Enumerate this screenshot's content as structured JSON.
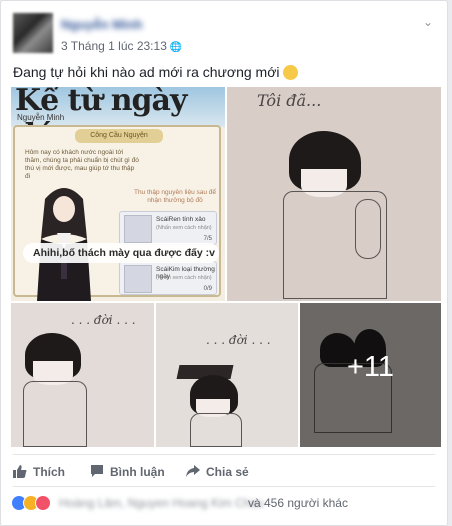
{
  "post": {
    "author_name": "Nguyễn Minh",
    "timestamp": "3 Tháng 1 lúc 23:13",
    "message": "Đang tự hỏi khi nào ad mới ra chương mới",
    "photos": {
      "game_title": "Kể từ ngày đó...",
      "game_player": "Nguyễn Minh",
      "game_panel_title": "Công Cầu Nguyện",
      "game_panel_text": "Hôm nay có khách nước ngoài tới thăm, chúng ta phải chuẩn bị chút gì đó thú vị mới được, mau giúp tớ thu thập đi",
      "game_collect_text": "Thu thập nguyên liệu sau để nhận thưởng bộ đồ",
      "game_item1_label": "ScáiRen tính xảo",
      "game_item1_sub": "(Nhấn xem cách nhận)",
      "game_item1_count": "7/5",
      "game_item2_label": "ScáiKim loại thường ngày",
      "game_item2_sub": "(Nhấn xem cách nhận)",
      "game_item2_count": "0/9",
      "game_caption": "Ahihi,bố thách mày qua được đấy :v",
      "drawing2_text": "Tôi đã...",
      "drawing3_text": ". . . đời . . .",
      "drawing4_text": ". . . đời . . .",
      "more_count": "+11"
    },
    "actions": {
      "like_label": "Thích",
      "comment_label": "Bình luận",
      "share_label": "Chia sẻ"
    },
    "reactions": {
      "names": "Hoàng Lâm, Nguyen Hoang Kim Chau",
      "others": "và 456 người khác"
    }
  },
  "colors": {
    "link_blue": "#365899",
    "like_blue": "#4080ff",
    "haha_yellow": "#f7b125",
    "love_red": "#f25268",
    "meta_gray": "#616770"
  }
}
